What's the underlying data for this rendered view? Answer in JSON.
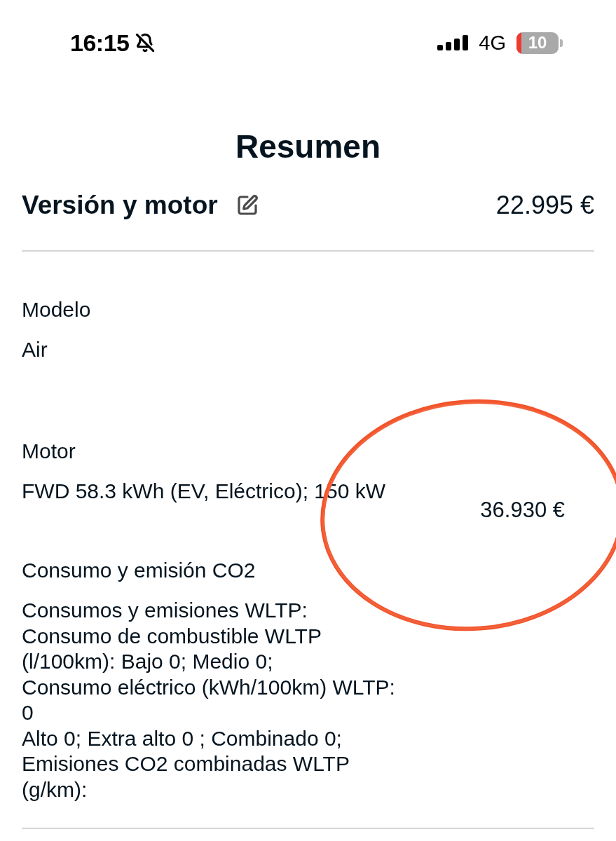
{
  "status_bar": {
    "time": "16:15",
    "silent": true,
    "network": "4G",
    "battery": "10"
  },
  "title": "Resumen",
  "section": {
    "title": "Versión y motor",
    "price": "22.995 €"
  },
  "details": [
    {
      "label": "Modelo",
      "value": "Air"
    },
    {
      "label": "Motor",
      "value": "FWD 58.3 kWh (EV, Eléctrico); 150 kW",
      "price": "36.930 €"
    },
    {
      "label": "Consumo y emisión CO2",
      "value": "Consumos y emisiones WLTP:\nConsumo de combustible WLTP\n(l/100km): Bajo 0; Medio 0;\nConsumo eléctrico (kWh/100km) WLTP:\n0\nAlto 0; Extra alto 0 ; Combinado 0;\nEmisiones CO2 combinadas WLTP\n(g/km):"
    }
  ]
}
